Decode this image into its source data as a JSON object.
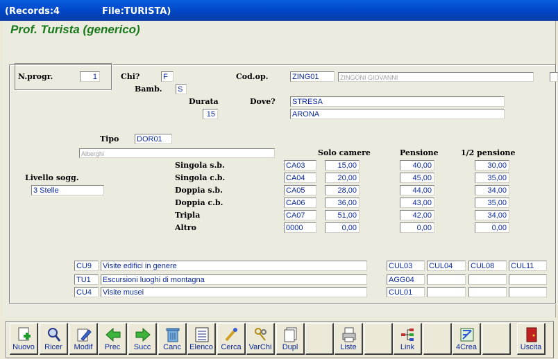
{
  "window": {
    "records": "(Records:4",
    "file": "File:TURISTA)"
  },
  "heading": "Prof. Turista (generico)",
  "form": {
    "nprogr_label": "N.progr.",
    "nprogr": "1",
    "chi_label": "Chi?",
    "chi": "F",
    "bamb_label": "Bamb.",
    "bamb": "S",
    "codop_label": "Cod.op.",
    "codop": "ZING01",
    "codop_name": "ZINGONI GIOVANNI",
    "durata_label": "Durata",
    "durata": "15",
    "dove_label": "Dove?",
    "dove1": "STRESA",
    "dove2": "ARONA",
    "tipo_label": "Tipo",
    "tipo": "DOR01",
    "tipo_desc": "Alberghi",
    "livello_label": "Livello sogg.",
    "livello": "3 Stelle"
  },
  "prices": {
    "headers": {
      "solo": "Solo camere",
      "pensione": "Pensione",
      "mezza": "1/2 pensione"
    },
    "rows": [
      {
        "label": "Singola s.b.",
        "code": "CA03",
        "solo": "15,00",
        "pensione": "40,00",
        "mezza": "30,00"
      },
      {
        "label": "Singola c.b.",
        "code": "CA04",
        "solo": "20,00",
        "pensione": "45,00",
        "mezza": "35,00"
      },
      {
        "label": "Doppia s.b.",
        "code": "CA05",
        "solo": "28,00",
        "pensione": "44,00",
        "mezza": "34,00"
      },
      {
        "label": "Doppia c.b.",
        "code": "CA06",
        "solo": "36,00",
        "pensione": "43,00",
        "mezza": "35,00"
      },
      {
        "label": "Tripla",
        "code": "CA07",
        "solo": "51,00",
        "pensione": "42,00",
        "mezza": "34,00"
      },
      {
        "label": "Altro",
        "code": "0000",
        "solo": "0,00",
        "pensione": "0,00",
        "mezza": "0,00"
      }
    ]
  },
  "activities": [
    {
      "code": "CU9",
      "desc": "Visite edifici in genere",
      "c1": "CUL03",
      "c2": "CUL04",
      "c3": "CUL08",
      "c4": "CUL11"
    },
    {
      "code": "TU1",
      "desc": "Escursioni luoghi di montagna",
      "c1": "AGG04",
      "c2": "",
      "c3": "",
      "c4": ""
    },
    {
      "code": "CU4",
      "desc": "Visite musei",
      "c1": "CUL01",
      "c2": "",
      "c3": "",
      "c4": ""
    }
  ],
  "toolbar": {
    "nuovo": "Nuovo",
    "ricer": "Ricer",
    "modif": "Modif",
    "prec": "Prec",
    "succ": "Succ",
    "canc": "Canc",
    "elenco": "Elenco",
    "cerca": "Cerca",
    "varchi": "VarChi",
    "dupl": "Dupl",
    "liste": "Liste",
    "link": "Link",
    "crea": "4Crea",
    "uscita": "Uscita"
  },
  "colors": {
    "title_bar": "#0047c8",
    "heading": "#17791a",
    "field_text": "#0b2a9c"
  }
}
